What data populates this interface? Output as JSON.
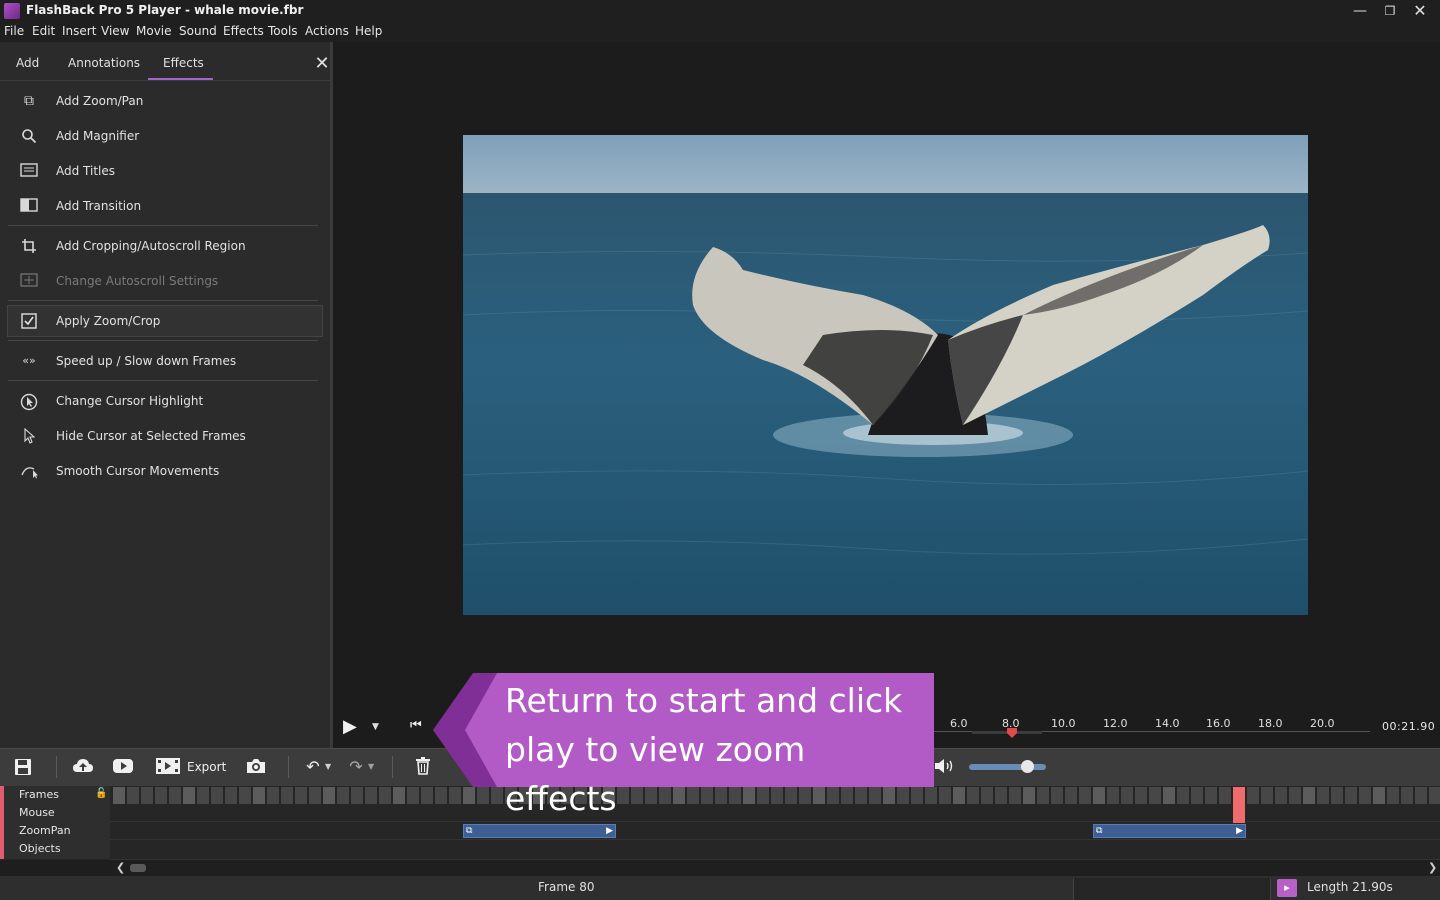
{
  "window": {
    "title": "FlashBack Pro 5 Player - whale movie.fbr",
    "controls": [
      "minimize-icon",
      "restore-icon",
      "close-icon"
    ]
  },
  "menu": [
    "File",
    "Edit",
    "Insert",
    "View",
    "Movie",
    "Sound",
    "Effects",
    "Tools",
    "Actions",
    "Help"
  ],
  "panel": {
    "tabs": [
      "Add",
      "Annotations",
      "Effects"
    ],
    "active_tab": "Effects",
    "close_icon": "close-icon",
    "items": [
      {
        "label": "Add Zoom/Pan",
        "icon": "zoom-pan-icon",
        "enabled": true
      },
      {
        "label": "Add Magnifier",
        "icon": "magnifier-icon",
        "enabled": true
      },
      {
        "label": "Add Titles",
        "icon": "titles-icon",
        "enabled": true
      },
      {
        "label": "Add Transition",
        "icon": "transition-icon",
        "enabled": true
      },
      {
        "label": "Add Cropping/Autoscroll Region",
        "icon": "crop-icon",
        "enabled": true
      },
      {
        "label": "Change Autoscroll Settings",
        "icon": "autoscroll-icon",
        "enabled": false
      },
      {
        "label": "Apply Zoom/Crop",
        "icon": "checkbox-checked-icon",
        "enabled": true,
        "selected": true
      },
      {
        "label": "Speed up / Slow down Frames",
        "icon": "speed-icon",
        "enabled": true
      },
      {
        "label": "Change Cursor Highlight",
        "icon": "cursor-highlight-icon",
        "enabled": true
      },
      {
        "label": "Hide Cursor at Selected Frames",
        "icon": "cursor-icon",
        "enabled": true
      },
      {
        "label": "Smooth Cursor Movements",
        "icon": "smooth-cursor-icon",
        "enabled": true
      }
    ]
  },
  "player": {
    "ruler_ticks": [
      "6.0",
      "8.0",
      "10.0",
      "12.0",
      "14.0",
      "16.0",
      "18.0",
      "20.0"
    ],
    "total_time": "00:21.90",
    "playhead_seconds": 8.0
  },
  "toolbar": {
    "export_label": "Export",
    "icons": [
      "save-icon",
      "upload-icon",
      "youtube-icon",
      "export-icon",
      "camera-icon",
      "undo-icon",
      "redo-icon",
      "delete-icon",
      "volume-icon"
    ],
    "volume_level": 0.75
  },
  "timeline": {
    "rows": [
      "Frames",
      "Mouse",
      "ZoomPan",
      "Objects"
    ],
    "frame_count": 100,
    "selected_frame_index": 80
  },
  "status": {
    "frame": "Frame 80",
    "length": "Length 21.90s"
  },
  "callout": {
    "text": "Return to start and click play to view zoom effects",
    "color": "#b25bc6"
  }
}
